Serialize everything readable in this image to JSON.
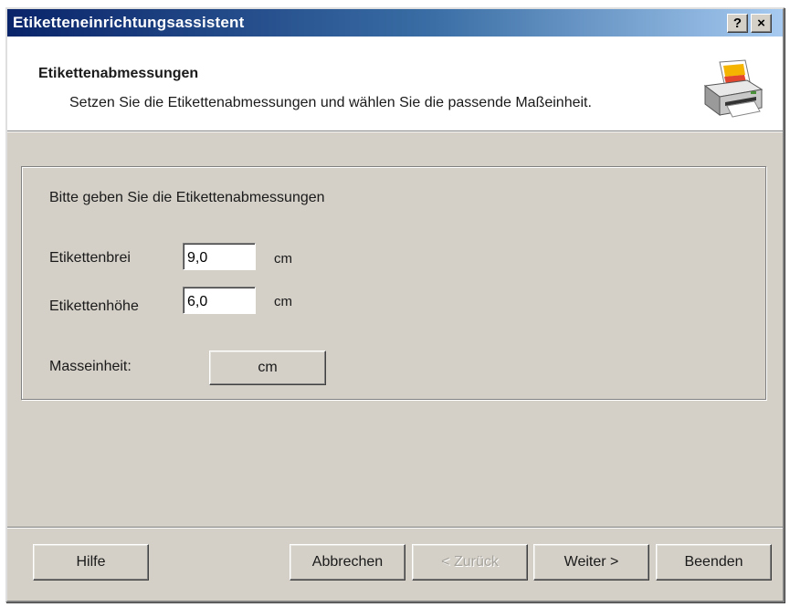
{
  "window": {
    "title": "Etiketteneinrichtungsassistent",
    "help_button": "?",
    "close_button": "×"
  },
  "header": {
    "title": "Etikettenabmessungen",
    "subtitle": "Setzen Sie die Etikettenabmessungen und wählen Sie die passende Maßeinheit.",
    "icon": "printer-icon"
  },
  "form": {
    "intro": "Bitte geben Sie die Etikettenabmessungen",
    "width_label": "Etikettenbrei",
    "width_value": "9,0",
    "width_unit": "cm",
    "height_label": "Etikettenhöhe",
    "height_value": "6,0",
    "height_unit": "cm",
    "unit_label": "Masseinheit:",
    "unit_button": "cm"
  },
  "footer": {
    "help": "Hilfe",
    "cancel": "Abbrechen",
    "back": "< Zurück",
    "next": "Weiter >",
    "finish": "Beenden"
  },
  "colors": {
    "title_bar_start": "#0a246a",
    "title_bar_end": "#a6caf0",
    "dialog_face": "#d4d0c8"
  }
}
